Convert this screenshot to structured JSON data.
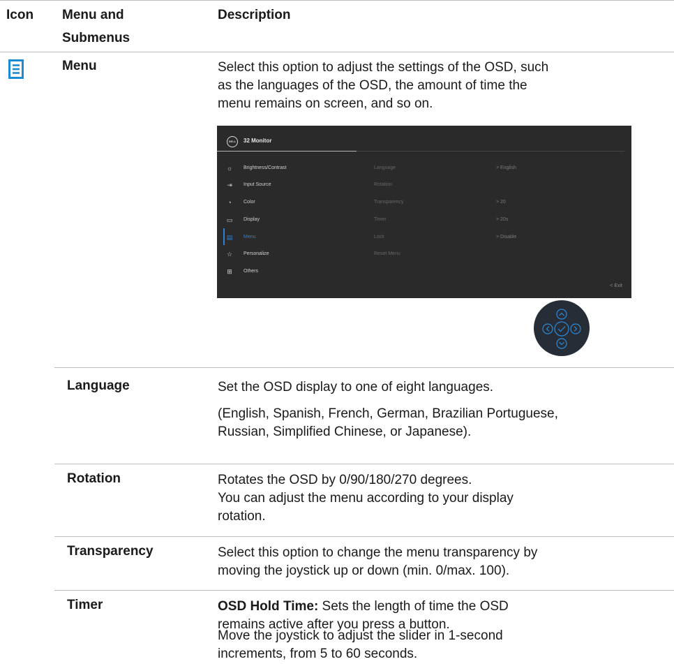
{
  "header": {
    "icon_col": "Icon",
    "menu_col_line1": "Menu and",
    "menu_col_line2": "Submenus",
    "desc_col": "Description"
  },
  "menu_row": {
    "label": "Menu",
    "icon": "document-lines-icon",
    "description_lines": [
      "Select this option to adjust the settings of the OSD, such",
      "as the languages of the OSD, the amount of time the",
      "menu remains on screen, and so on."
    ]
  },
  "osd": {
    "logo": "DELL",
    "title": "32 Monitor",
    "menu_items": [
      {
        "label": "Brightness/Contrast",
        "icon": "sun-icon"
      },
      {
        "label": "Input Source",
        "icon": "input-icon"
      },
      {
        "label": "Color",
        "icon": "palette-icon"
      },
      {
        "label": "Display",
        "icon": "display-icon"
      },
      {
        "label": "Menu",
        "icon": "menu-icon",
        "active": true
      },
      {
        "label": "Personalize",
        "icon": "star-icon"
      },
      {
        "label": "Others",
        "icon": "others-icon"
      }
    ],
    "settings": [
      {
        "label": "Language",
        "value": ">  English"
      },
      {
        "label": "Rotation",
        "value": ""
      },
      {
        "label": "Transparency",
        "value": ">  20"
      },
      {
        "label": "Timer",
        "value": ">  20s"
      },
      {
        "label": "Lock",
        "value": ">  Disable"
      },
      {
        "label": "Reset Menu",
        "value": ""
      }
    ],
    "exit": "<  Exit",
    "accent_color": "#2f7fd6"
  },
  "joystick": {
    "icons": [
      "up-arrow-icon",
      "left-arrow-icon",
      "check-icon",
      "right-arrow-icon",
      "down-arrow-icon"
    ],
    "color": "#2e8bd8"
  },
  "rows": [
    {
      "label": "Language",
      "paragraphs": [
        [
          "Set the OSD display to one of eight languages."
        ],
        [
          "(English, Spanish, French, German, Brazilian Portuguese,",
          "Russian, Simplified Chinese, or Japanese)."
        ]
      ]
    },
    {
      "label": "Rotation",
      "paragraphs": [
        [
          "Rotates the OSD by 0/90/180/270 degrees.",
          "You can adjust the menu according to your display",
          "rotation."
        ]
      ]
    },
    {
      "label": "Transparency",
      "paragraphs": [
        [
          "Select this option to change the menu transparency by",
          "moving the joystick up or down (min. 0/max. 100)."
        ]
      ]
    },
    {
      "label": "Timer",
      "bold_prefix": "OSD Hold Time:",
      "paragraphs": [
        [
          " Sets the length of time the OSD",
          "remains active after you press a button."
        ],
        [
          "Move the joystick to adjust the slider in 1-second",
          "increments, from 5 to 60 seconds."
        ]
      ]
    }
  ]
}
